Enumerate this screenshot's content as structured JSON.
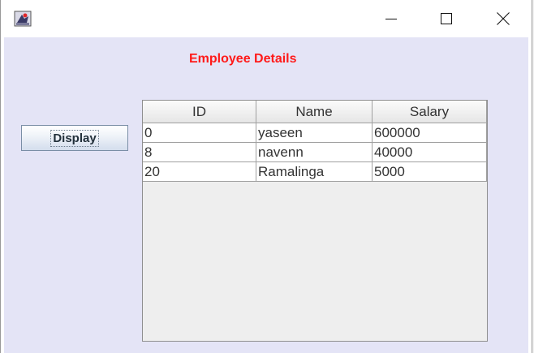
{
  "window": {
    "controls": {
      "minimize": "minimize-icon",
      "maximize": "maximize-icon",
      "close": "close-icon"
    },
    "app_icon": "java-app-icon"
  },
  "content": {
    "heading": "Employee Details",
    "display_button_label": "Display",
    "accent_color": "#ff1a1a",
    "background_color": "#e4e4f6"
  },
  "table": {
    "columns": [
      "ID",
      "Name",
      "Salary"
    ],
    "rows": [
      [
        "0",
        "yaseen",
        "600000"
      ],
      [
        "8",
        "navenn",
        "40000"
      ],
      [
        "20",
        "Ramalinga",
        "5000"
      ]
    ]
  }
}
